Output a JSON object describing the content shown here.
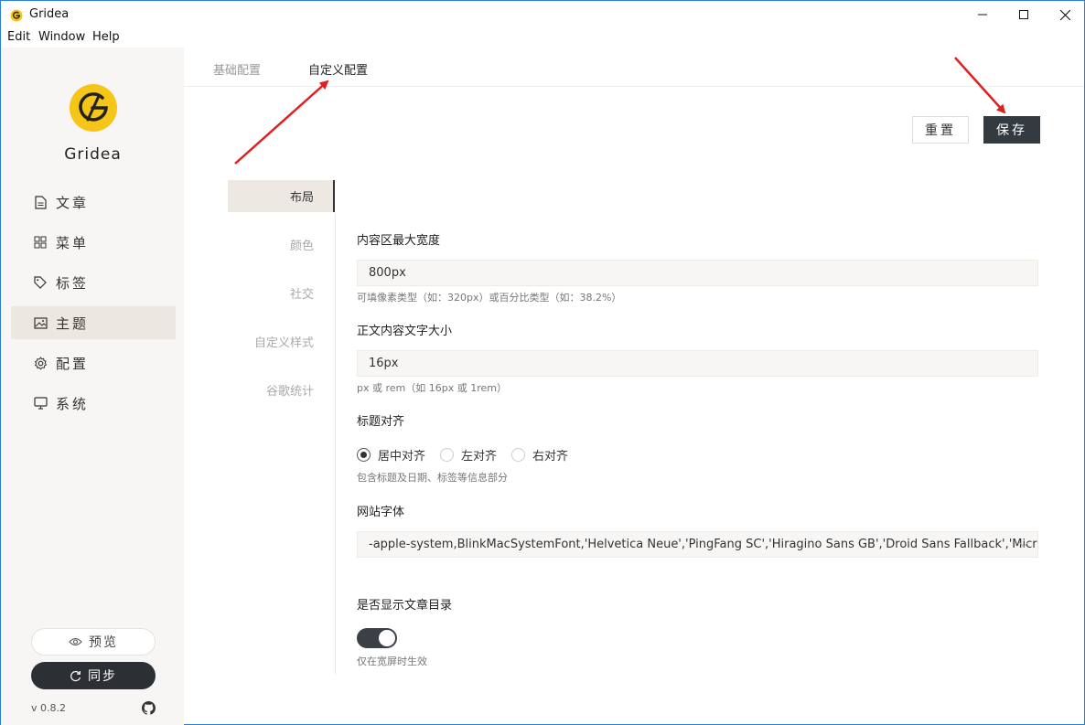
{
  "window": {
    "title": "Gridea"
  },
  "menu": [
    "Edit",
    "Window",
    "Help"
  ],
  "sidebar": {
    "brand": "Gridea",
    "items": [
      {
        "label": "文章",
        "icon": "file-icon"
      },
      {
        "label": "菜单",
        "icon": "grid-icon"
      },
      {
        "label": "标签",
        "icon": "tag-icon"
      },
      {
        "label": "主题",
        "icon": "image-icon",
        "active": true
      },
      {
        "label": "配置",
        "icon": "gear-icon"
      },
      {
        "label": "系统",
        "icon": "monitor-icon"
      }
    ],
    "preview_label": "预览",
    "sync_label": "同步",
    "version": "v 0.8.2"
  },
  "tabs": {
    "basic": "基础配置",
    "custom": "自定义配置"
  },
  "actions": {
    "reset": "重置",
    "save": "保存"
  },
  "subnav": [
    "布局",
    "颜色",
    "社交",
    "自定义样式",
    "谷歌统计"
  ],
  "form": {
    "max_width": {
      "label": "内容区最大宽度",
      "value": "800px",
      "hint": "可填像素类型（如：320px）或百分比类型（如：38.2%）"
    },
    "font_size": {
      "label": "正文内容文字大小",
      "value": "16px",
      "hint": "px 或 rem（如 16px 或 1rem）"
    },
    "title_align": {
      "label": "标题对齐",
      "options": [
        "居中对齐",
        "左对齐",
        "右对齐"
      ],
      "selected": "居中对齐",
      "hint": "包含标题及日期、标签等信息部分"
    },
    "site_font": {
      "label": "网站字体",
      "value": "-apple-system,BlinkMacSystemFont,'Helvetica Neue','PingFang SC','Hiragino Sans GB','Droid Sans Fallback','Micro..."
    },
    "show_toc": {
      "label": "是否显示文章目录",
      "enabled": true,
      "hint": "仅在宽屏时生效"
    }
  },
  "colors": {
    "accent": "#333a40",
    "sidebar_bg": "#f8f6f4",
    "active_bg": "#ede8e2",
    "annotation": "#e02020",
    "logo_yellow": "#f5c518"
  }
}
